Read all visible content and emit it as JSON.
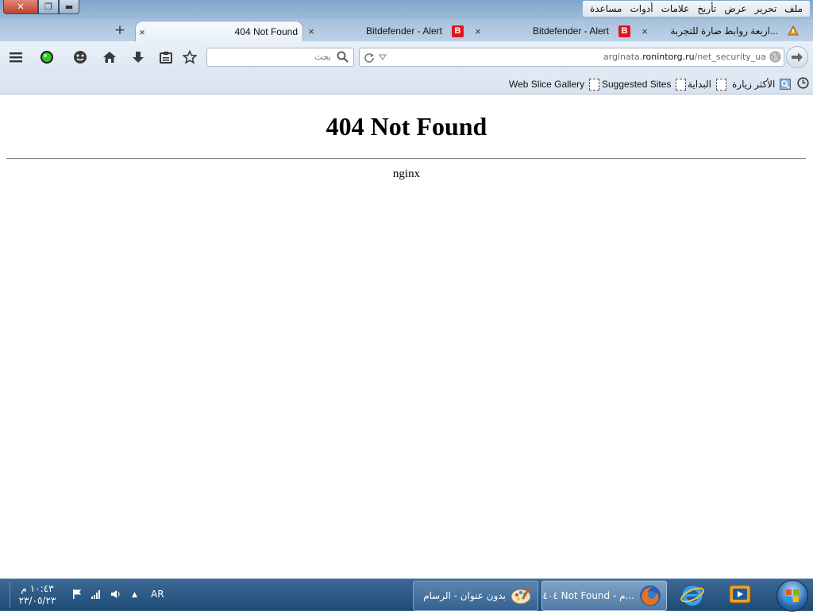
{
  "window": {
    "close_glyph": "✕",
    "restore_glyph": "❐",
    "minimize_glyph": "▬"
  },
  "menu": {
    "items": [
      "ملف",
      "تحرير",
      "عرض",
      "تأريخ",
      "علامات",
      "أدوات",
      "مساعدة"
    ]
  },
  "tabs": {
    "new_tab_glyph": "+",
    "close_glyph": "×",
    "items": [
      {
        "title": "404 Not Found"
      },
      {
        "title": "Bitdefender - Alert",
        "badge": "B"
      },
      {
        "title": "Bitdefender - Alert",
        "badge": "B"
      },
      {
        "title": "اربعة روابط ضارة للتجربة..."
      }
    ]
  },
  "search": {
    "placeholder": "بحث"
  },
  "urlbar": {
    "prefix": "arginata.",
    "domain": "ronintorg.ru",
    "path": "/net_security_ua"
  },
  "bookmarks": {
    "items": [
      "الأكثر زيارة",
      "البداية",
      "Suggested Sites",
      "Web Slice Gallery"
    ]
  },
  "content": {
    "heading": "404 Not Found",
    "server": "nginx"
  },
  "taskbar": {
    "time": "١٠:٤٣ م",
    "date": "٢٣/٠٥/٢٣",
    "language": "AR",
    "tray_up": "▲",
    "firefox_task": "٤٠٤ Not Found - م...",
    "paint_task": "بدون عنوان - الرسام"
  },
  "colors": {
    "accent": "#3c6a95",
    "badge": "#e1161b"
  }
}
